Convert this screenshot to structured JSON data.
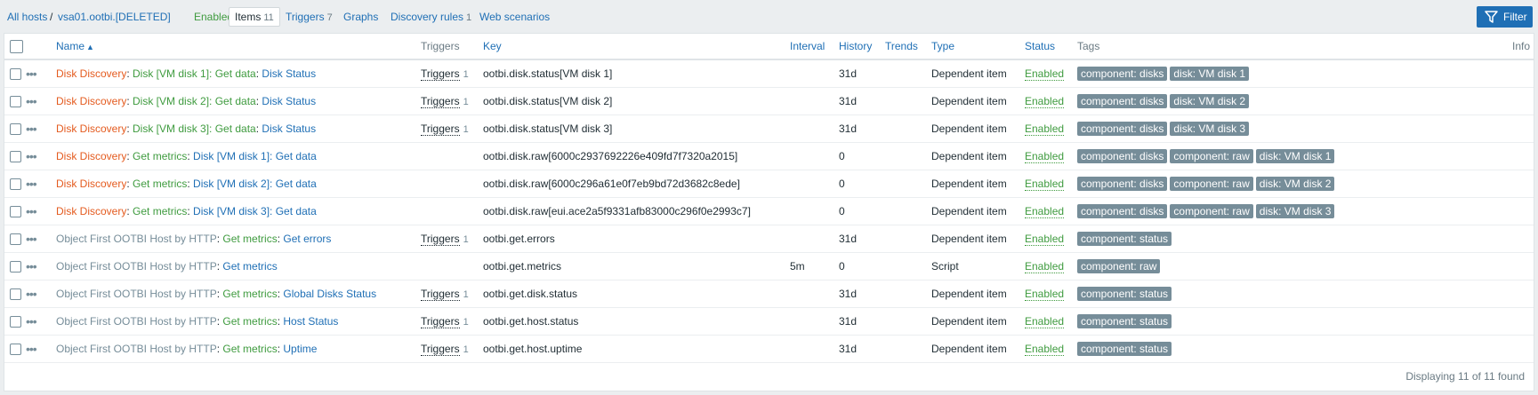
{
  "breadcrumb": {
    "all_hosts": "All hosts",
    "separator": "/",
    "host": "vsa01.ootbi.[DELETED]",
    "status": "Enabled"
  },
  "tabs": [
    {
      "label": "Items",
      "count": "11",
      "active": true
    },
    {
      "label": "Triggers",
      "count": "7"
    },
    {
      "label": "Graphs",
      "count": ""
    },
    {
      "label": "Discovery rules",
      "count": "1"
    },
    {
      "label": "Web scenarios",
      "count": ""
    }
  ],
  "filter_label": "Filter",
  "columns": {
    "name": "Name",
    "triggers": "Triggers",
    "key": "Key",
    "interval": "Interval",
    "history": "History",
    "trends": "Trends",
    "type": "Type",
    "status": "Status",
    "tags": "Tags",
    "info": "Info"
  },
  "rows": [
    {
      "prefix1": "Disk Discovery",
      "prefix1_color": "orange",
      "prefix2": "Disk [VM disk 1]: Get data",
      "prefix2_color": "green",
      "name": "Disk Status",
      "triggers": "Triggers",
      "trigger_count": "1",
      "key": "ootbi.disk.status[VM disk 1]",
      "interval": "",
      "history": "31d",
      "trends": "",
      "type": "Dependent item",
      "status": "Enabled",
      "tags": [
        "component: disks",
        "disk: VM disk 1"
      ]
    },
    {
      "prefix1": "Disk Discovery",
      "prefix1_color": "orange",
      "prefix2": "Disk [VM disk 2]: Get data",
      "prefix2_color": "green",
      "name": "Disk Status",
      "triggers": "Triggers",
      "trigger_count": "1",
      "key": "ootbi.disk.status[VM disk 2]",
      "interval": "",
      "history": "31d",
      "trends": "",
      "type": "Dependent item",
      "status": "Enabled",
      "tags": [
        "component: disks",
        "disk: VM disk 2"
      ]
    },
    {
      "prefix1": "Disk Discovery",
      "prefix1_color": "orange",
      "prefix2": "Disk [VM disk 3]: Get data",
      "prefix2_color": "green",
      "name": "Disk Status",
      "triggers": "Triggers",
      "trigger_count": "1",
      "key": "ootbi.disk.status[VM disk 3]",
      "interval": "",
      "history": "31d",
      "trends": "",
      "type": "Dependent item",
      "status": "Enabled",
      "tags": [
        "component: disks",
        "disk: VM disk 3"
      ]
    },
    {
      "prefix1": "Disk Discovery",
      "prefix1_color": "orange",
      "prefix2": "Get metrics",
      "prefix2_color": "green",
      "name": "Disk [VM disk 1]: Get data",
      "triggers": "",
      "trigger_count": "",
      "key": "ootbi.disk.raw[6000c2937692226e409fd7f7320a2015]",
      "interval": "",
      "history": "0",
      "trends": "",
      "type": "Dependent item",
      "status": "Enabled",
      "tags": [
        "component: disks",
        "component: raw",
        "disk: VM disk 1"
      ]
    },
    {
      "prefix1": "Disk Discovery",
      "prefix1_color": "orange",
      "prefix2": "Get metrics",
      "prefix2_color": "green",
      "name": "Disk [VM disk 2]: Get data",
      "triggers": "",
      "trigger_count": "",
      "key": "ootbi.disk.raw[6000c296a61e0f7eb9bd72d3682c8ede]",
      "interval": "",
      "history": "0",
      "trends": "",
      "type": "Dependent item",
      "status": "Enabled",
      "tags": [
        "component: disks",
        "component: raw",
        "disk: VM disk 2"
      ]
    },
    {
      "prefix1": "Disk Discovery",
      "prefix1_color": "orange",
      "prefix2": "Get metrics",
      "prefix2_color": "green",
      "name": "Disk [VM disk 3]: Get data",
      "triggers": "",
      "trigger_count": "",
      "key": "ootbi.disk.raw[eui.ace2a5f9331afb83000c296f0e2993c7]",
      "interval": "",
      "history": "0",
      "trends": "",
      "type": "Dependent item",
      "status": "Enabled",
      "tags": [
        "component: disks",
        "component: raw",
        "disk: VM disk 3"
      ]
    },
    {
      "prefix1": "Object First OOTBI Host by HTTP",
      "prefix1_color": "grey",
      "prefix2": "Get metrics",
      "prefix2_color": "green",
      "name": "Get errors",
      "triggers": "Triggers",
      "trigger_count": "1",
      "key": "ootbi.get.errors",
      "interval": "",
      "history": "31d",
      "trends": "",
      "type": "Dependent item",
      "status": "Enabled",
      "tags": [
        "component: status"
      ]
    },
    {
      "prefix1": "Object First OOTBI Host by HTTP",
      "prefix1_color": "grey",
      "prefix2": "",
      "prefix2_color": "",
      "name": "Get metrics",
      "triggers": "",
      "trigger_count": "",
      "key": "ootbi.get.metrics",
      "interval": "5m",
      "history": "0",
      "trends": "",
      "type": "Script",
      "status": "Enabled",
      "tags": [
        "component: raw"
      ]
    },
    {
      "prefix1": "Object First OOTBI Host by HTTP",
      "prefix1_color": "grey",
      "prefix2": "Get metrics",
      "prefix2_color": "green",
      "name": "Global Disks Status",
      "triggers": "Triggers",
      "trigger_count": "1",
      "key": "ootbi.get.disk.status",
      "interval": "",
      "history": "31d",
      "trends": "",
      "type": "Dependent item",
      "status": "Enabled",
      "tags": [
        "component: status"
      ]
    },
    {
      "prefix1": "Object First OOTBI Host by HTTP",
      "prefix1_color": "grey",
      "prefix2": "Get metrics",
      "prefix2_color": "green",
      "name": "Host Status",
      "triggers": "Triggers",
      "trigger_count": "1",
      "key": "ootbi.get.host.status",
      "interval": "",
      "history": "31d",
      "trends": "",
      "type": "Dependent item",
      "status": "Enabled",
      "tags": [
        "component: status"
      ]
    },
    {
      "prefix1": "Object First OOTBI Host by HTTP",
      "prefix1_color": "grey",
      "prefix2": "Get metrics",
      "prefix2_color": "green",
      "name": "Uptime",
      "triggers": "Triggers",
      "trigger_count": "1",
      "key": "ootbi.get.host.uptime",
      "interval": "",
      "history": "31d",
      "trends": "",
      "type": "Dependent item",
      "status": "Enabled",
      "tags": [
        "component: status"
      ]
    }
  ],
  "footer": "Displaying 11 of 11 found",
  "colors": {
    "orange": "#e45b1f",
    "green": "#3f9b3f",
    "grey": "#768d99",
    "link_blue": "#1f6fb5",
    "tag_bg": "#768d99"
  }
}
